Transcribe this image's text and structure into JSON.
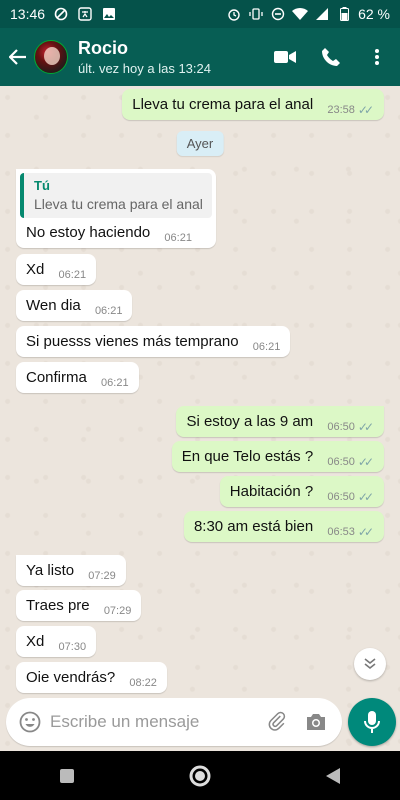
{
  "status_bar": {
    "time": "13:46",
    "battery": "62 %",
    "icons_left": [
      "do-not-disturb-icon",
      "translate-icon",
      "image-icon"
    ],
    "icons_right": [
      "alarm-icon",
      "vibrate-icon",
      "dnd-icon",
      "wifi-icon",
      "signal-icon",
      "battery-icon"
    ]
  },
  "header": {
    "name": "Rocio",
    "status": "últ. vez hoy a las 13:24"
  },
  "date_chip": "Ayer",
  "messages": [
    {
      "dir": "out",
      "text": "Lleva tu crema para el anal",
      "time": "23:58",
      "read": true
    },
    {
      "dir": "in",
      "quote_author": "Tú",
      "quote_text": "Lleva tu crema para el anal",
      "text": "No estoy haciendo",
      "time": "06:21"
    },
    {
      "dir": "in",
      "text": "Xd",
      "time": "06:21"
    },
    {
      "dir": "in",
      "text": "Wen dia",
      "time": "06:21"
    },
    {
      "dir": "in",
      "text": "Si puesss vienes más temprano",
      "time": "06:21"
    },
    {
      "dir": "in",
      "text": "Confirma",
      "time": "06:21"
    },
    {
      "dir": "out",
      "text": "Si estoy a las 9 am",
      "time": "06:50",
      "read": true
    },
    {
      "dir": "out",
      "text": "En que Telo estás ?",
      "time": "06:50",
      "read": true
    },
    {
      "dir": "out",
      "text": "Habitación ?",
      "time": "06:50",
      "read": true
    },
    {
      "dir": "out",
      "text": "8:30 am está bien",
      "time": "06:53",
      "read": true
    },
    {
      "dir": "in",
      "text": "Ya listo",
      "time": "07:29"
    },
    {
      "dir": "in",
      "text": "Traes pre",
      "time": "07:29"
    },
    {
      "dir": "in",
      "text": "Xd",
      "time": "07:30"
    },
    {
      "dir": "in",
      "text": "Oie vendrás?",
      "time": "08:22"
    }
  ],
  "composer": {
    "placeholder": "Escribe un mensaje"
  },
  "colors": {
    "header": "#075e54",
    "outgoing": "#dcf8c6",
    "incoming": "#ffffff",
    "accent": "#00897b",
    "chat_bg": "#ece5dd"
  }
}
